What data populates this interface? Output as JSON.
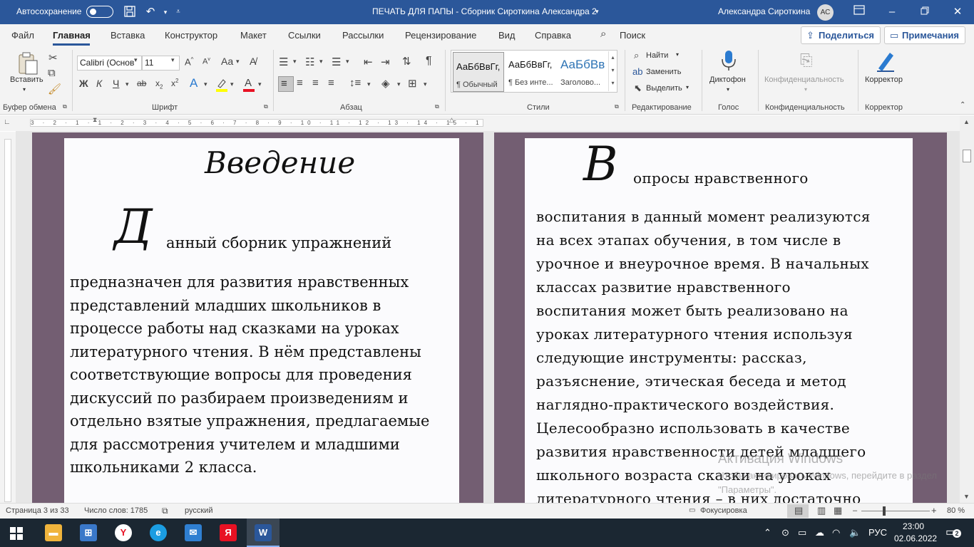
{
  "title_bar": {
    "autosave_label": "Автосохранение",
    "document_title": "ПЕЧАТЬ ДЛЯ ПАПЫ - Сборник Сироткина Александра 2",
    "user_name": "Александра Сироткина",
    "user_initials": "АС"
  },
  "tabs": [
    "Файл",
    "Главная",
    "Вставка",
    "Конструктор",
    "Макет",
    "Ссылки",
    "Рассылки",
    "Рецензирование",
    "Вид",
    "Справка"
  ],
  "active_tab": "Главная",
  "search_label": "Поиск",
  "share_label": "Поделиться",
  "comments_label": "Примечания",
  "ribbon": {
    "clipboard": {
      "paste_label": "Вставить",
      "group_label": "Буфер обмена"
    },
    "font": {
      "font_name": "Calibri (Основ",
      "font_size": "11",
      "group_label": "Шрифт",
      "bold": "Ж",
      "italic": "К",
      "underline": "Ч"
    },
    "paragraph": {
      "group_label": "Абзац"
    },
    "styles": {
      "items": [
        {
          "preview": "АаБбВвГг,",
          "name": "¶ Обычный"
        },
        {
          "preview": "АаБбВвГг,",
          "name": "¶ Без инте..."
        },
        {
          "preview": "АаБбВв",
          "name": "Заголово..."
        }
      ],
      "group_label": "Стили"
    },
    "editing": {
      "find_label": "Найти",
      "replace_label": "Заменить",
      "select_label": "Выделить",
      "group_label": "Редактирование"
    },
    "voice": {
      "dictate_label": "Диктофон",
      "group_label": "Голос"
    },
    "privacy": {
      "label": "Конфиденциальность",
      "group_label": "Конфиденциальность"
    },
    "editor": {
      "label": "Корректор",
      "group_label": "Корректор"
    }
  },
  "ruler_text": "3 · 2 · 1 · 1 · 2 · 3 · 4 · 5 · 6 · 7 · 8 · 9 · 10 · 11 · 12 · 13 · 14 · 15 · 16 · 17",
  "page_left": {
    "heading": "Введение",
    "dropcap": "Д",
    "first_line": "анный сборник упражнений",
    "lines": [
      "предназначен для развития нравственных",
      "представлений младших школьников в",
      "процессе работы над сказками на уроках",
      "литературного чтения. В нём представлены",
      "соответствующие вопросы для проведения",
      "дискуссий по разбираем произведениям и",
      "отдельно взятые упражнения, предлагаемые",
      "для рассмотрения учителем и младшими",
      "школьниками 2 класса."
    ]
  },
  "page_right": {
    "dropcap": "В",
    "first_line": "опросы нравственного",
    "lines": [
      "воспитания в данный момент реализуются",
      "на всех этапах обучения, в том числе в",
      "урочное и внеурочное время. В начальных",
      "классах развитие нравственного",
      "воспитания может быть реализовано на",
      "уроках литературного чтения используя",
      "следующие инструменты: рассказ,",
      "разъяснение, этическая беседа и метод",
      "наглядно-практического воздействия.",
      "Целесообразно использовать в качестве",
      "развития нравственности детей младшего",
      "школьного возраста сказки на уроках",
      "литературного чтения – в них достаточно"
    ]
  },
  "watermark": {
    "title": "Активация Windows",
    "subtitle": "Чтобы активировать Windows, перейдите в раздел \"Параметры\"."
  },
  "status_bar": {
    "page": "Страница 3 из 33",
    "words": "Число слов: 1785",
    "language": "русский",
    "focus": "Фокусировка",
    "zoom": "80 %"
  },
  "taskbar": {
    "language": "РУС",
    "time": "23:00",
    "date": "02.06.2022",
    "notifications": "2"
  }
}
